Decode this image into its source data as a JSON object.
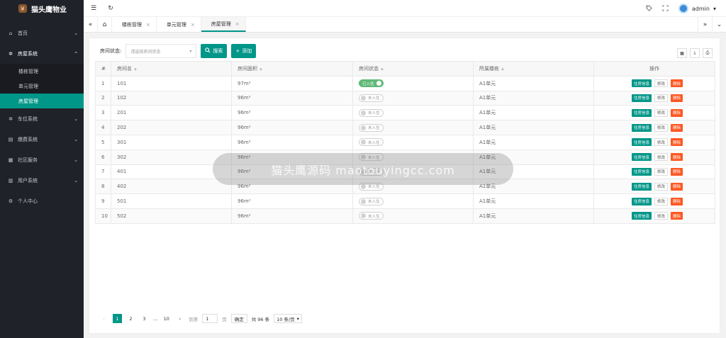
{
  "app": {
    "title": "猫头鹰物业"
  },
  "sidebar": {
    "items": [
      {
        "label": "首页",
        "icon": "home-icon",
        "chevron": "⌄"
      },
      {
        "label": "房屋系统",
        "icon": "gear-icon",
        "chevron": "⌃"
      },
      {
        "label": "车位系统",
        "icon": "gear-icon",
        "chevron": "⌄"
      },
      {
        "label": "缴费系统",
        "icon": "money-icon",
        "chevron": "⌄"
      },
      {
        "label": "社区服务",
        "icon": "grid-icon",
        "chevron": "⌄"
      },
      {
        "label": "用户系统",
        "icon": "users-icon",
        "chevron": "⌄"
      },
      {
        "label": "个人中心",
        "icon": "settings-icon",
        "chevron": ""
      }
    ],
    "sub_items": [
      "楼栋管理",
      "单元管理",
      "房屋管理"
    ]
  },
  "header": {
    "username": "admin",
    "menu_icon": "☰",
    "refresh_icon": "↻"
  },
  "tabs": {
    "items": [
      "楼栋管理",
      "单元管理",
      "房屋管理"
    ],
    "active": "房屋管理",
    "home_icon": "⌂"
  },
  "filter": {
    "label": "房间状态:",
    "placeholder": "请选择房间状态",
    "search_label": "搜索",
    "add_label": "添加"
  },
  "table": {
    "headers": [
      "#",
      "房间名",
      "房间面积",
      "房间状态",
      "所属楼栋",
      "操作"
    ],
    "rows": [
      {
        "no": "1",
        "name": "101",
        "area": "97m²",
        "status": "已入住",
        "occupied": true,
        "building": "A1单元"
      },
      {
        "no": "2",
        "name": "102",
        "area": "96m²",
        "status": "未入住",
        "occupied": false,
        "building": "A1单元"
      },
      {
        "no": "3",
        "name": "201",
        "area": "96m²",
        "status": "未入住",
        "occupied": false,
        "building": "A1单元"
      },
      {
        "no": "4",
        "name": "202",
        "area": "96m²",
        "status": "未入住",
        "occupied": false,
        "building": "A1单元"
      },
      {
        "no": "5",
        "name": "301",
        "area": "96m²",
        "status": "未入住",
        "occupied": false,
        "building": "A1单元"
      },
      {
        "no": "6",
        "name": "302",
        "area": "96m²",
        "status": "未入住",
        "occupied": false,
        "building": "A1单元"
      },
      {
        "no": "7",
        "name": "401",
        "area": "96m²",
        "status": "未入住",
        "occupied": false,
        "building": "A1单元"
      },
      {
        "no": "8",
        "name": "402",
        "area": "96m²",
        "status": "未入住",
        "occupied": false,
        "building": "A1单元"
      },
      {
        "no": "9",
        "name": "501",
        "area": "96m²",
        "status": "未入住",
        "occupied": false,
        "building": "A1单元"
      },
      {
        "no": "10",
        "name": "502",
        "area": "96m²",
        "status": "未入住",
        "occupied": false,
        "building": "A1单元"
      }
    ],
    "actions": {
      "info": "住房信息",
      "edit": "修改",
      "delete": "删除"
    }
  },
  "pagination": {
    "pages": [
      "1",
      "2",
      "3",
      "...",
      "10"
    ],
    "current": "1",
    "goto_label": "到第",
    "goto_value": "1",
    "page_suffix": "页",
    "confirm": "确定",
    "total": "共 96 条",
    "page_size": "10 条/页"
  },
  "watermark": {
    "text": "猫头鹰源码 maotouyingcc.com"
  },
  "colors": {
    "accent": "#009688",
    "sidebar": "#20222a",
    "danger": "#ff5722",
    "switch_on": "#5fb878"
  }
}
